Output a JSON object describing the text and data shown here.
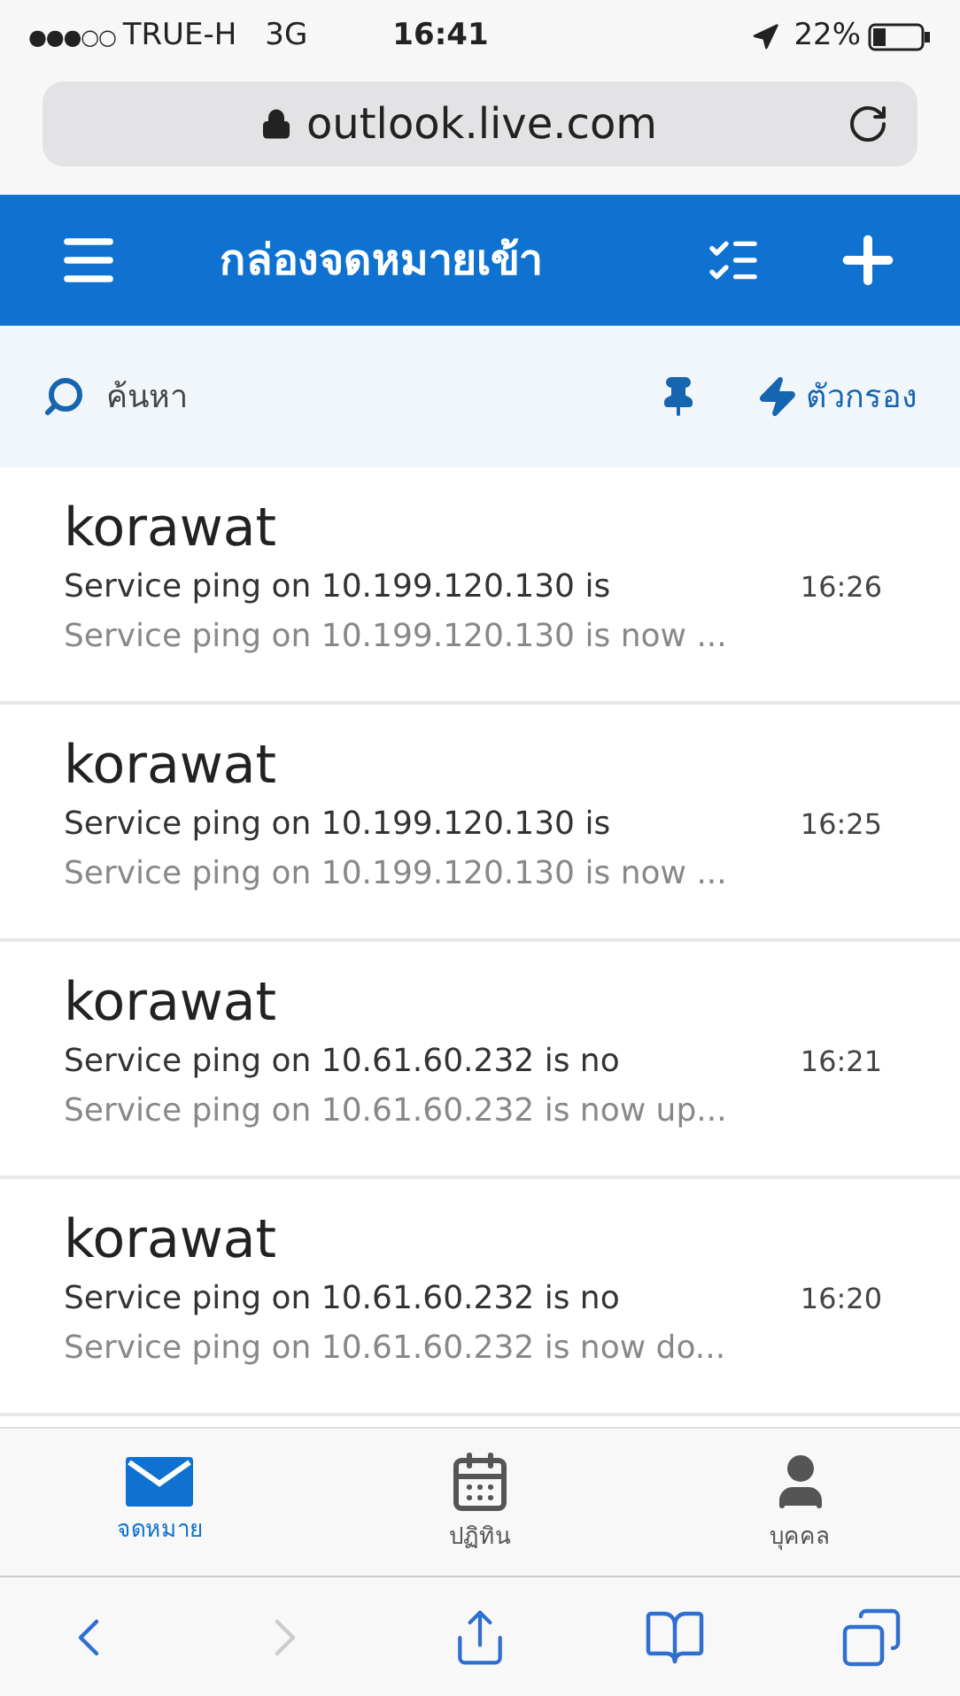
{
  "status_bar": {
    "signal": "●●●○○",
    "carrier": "TRUE-H",
    "network": "3G",
    "time": "16:41",
    "battery": "22%"
  },
  "address_bar": {
    "url": "outlook.live.com"
  },
  "header": {
    "title": "กล่องจดหมายเข้า"
  },
  "toolbar": {
    "search_label": "ค้นหา",
    "filter_label": "ตัวกรอง"
  },
  "messages": [
    {
      "sender": "korawat",
      "subject": "Service ping on 10.199.120.130 is",
      "preview": "Service ping on 10.199.120.130 is now ...",
      "time": "16:26"
    },
    {
      "sender": "korawat",
      "subject": "Service ping on 10.199.120.130 is",
      "preview": "Service ping on 10.199.120.130 is now ...",
      "time": "16:25"
    },
    {
      "sender": "korawat",
      "subject": "Service ping on 10.61.60.232 is no",
      "preview": "Service ping on 10.61.60.232 is now up...",
      "time": "16:21"
    },
    {
      "sender": "korawat",
      "subject": "Service ping on 10.61.60.232 is no",
      "preview": "Service ping on 10.61.60.232 is now do...",
      "time": "16:20"
    }
  ],
  "tabs": [
    {
      "kind": "mail",
      "label": "จดหมาย",
      "selected": true
    },
    {
      "kind": "calendar",
      "label": "ปฏิทิน",
      "selected": false
    },
    {
      "kind": "people",
      "label": "บุคคล",
      "selected": false
    }
  ],
  "browser_toolbar": {
    "back_disabled": false,
    "forward_disabled": true
  }
}
